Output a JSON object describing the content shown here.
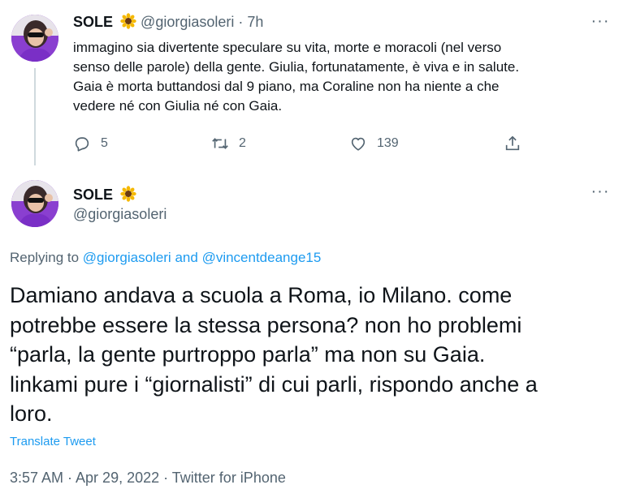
{
  "tweet1": {
    "name": "SOLE",
    "handle": "@giorgiasoleri",
    "separator": "·",
    "time": "7h",
    "text_lines": [
      "immagino sia divertente speculare su vita, morte e moracoli (nel verso",
      "senso delle parole) della gente. Giulia, fortunatamente, è viva e in salute.",
      "Gaia è morta buttandosi dal 9 piano, ma Coraline non ha niente a che",
      "vedere né con Giulia né con Gaia."
    ],
    "replies": "5",
    "retweets": "2",
    "likes": "139",
    "more": "···"
  },
  "tweet2": {
    "name": "SOLE",
    "handle": "@giorgiasoleri",
    "more": "···",
    "replying_prefix": "Replying to",
    "replying_user1": "@giorgiasoleri",
    "replying_and": "and",
    "replying_user2": "@vincentdeange15",
    "text_lines": [
      "Damiano andava a scuola a Roma, io Milano. come",
      "potrebbe essere la stessa persona? non ho problemi",
      "“parla, la gente purtroppo parla” ma non su Gaia.",
      "linkami pure i “giornalisti” di cui parli, rispondo anche a",
      "loro."
    ],
    "translate": "Translate Tweet",
    "timestamp": "3:57 AM · Apr 29, 2022 · Twitter for iPhone"
  },
  "colors": {
    "link": "#1d9bf0",
    "secondary": "#536471",
    "text": "#0f1419",
    "avatar_bg": "#8a3fd0"
  },
  "icons": [
    "reply-icon",
    "retweet-icon",
    "like-icon",
    "share-icon",
    "sunflower-emoji",
    "more-icon"
  ]
}
